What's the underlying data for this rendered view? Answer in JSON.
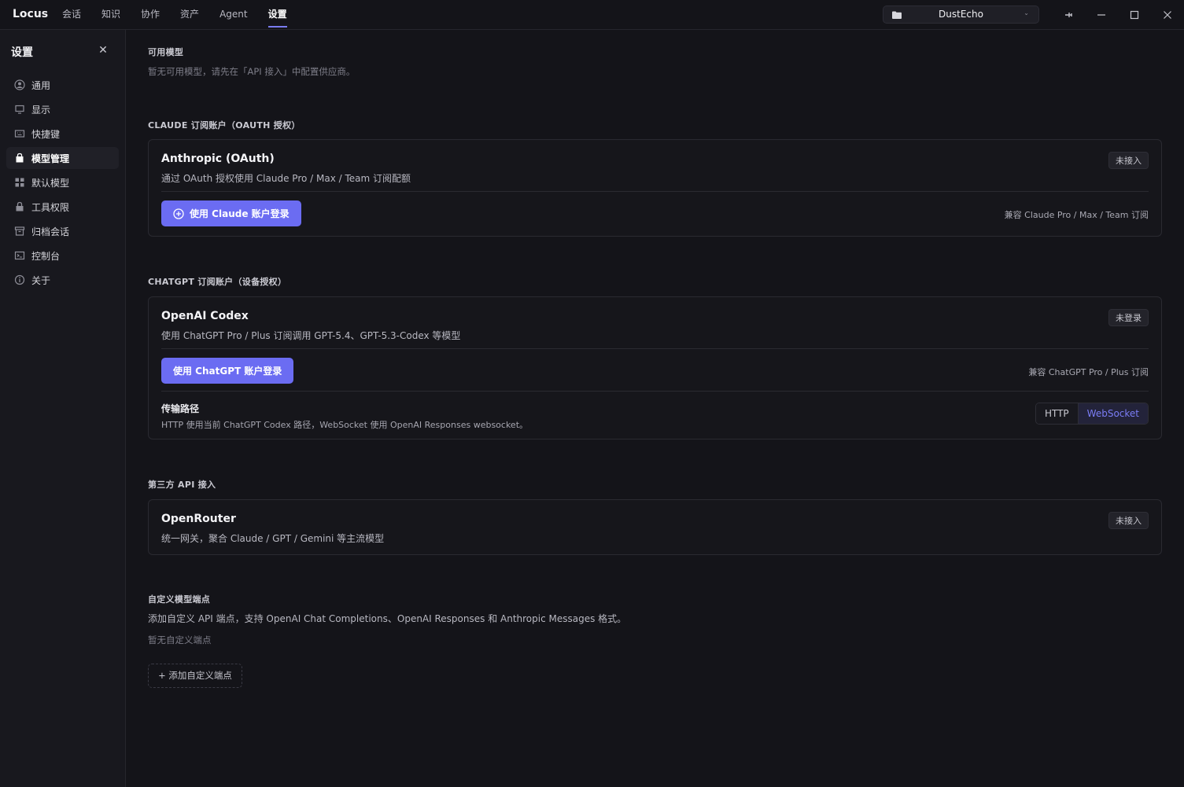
{
  "app": {
    "brand": "Locus",
    "nav": [
      "会话",
      "知识",
      "协作",
      "资产",
      "Agent",
      "设置"
    ],
    "workspace": "DustEcho"
  },
  "sidebar": {
    "title": "设置",
    "items": [
      "通用",
      "显示",
      "快捷键",
      "模型管理",
      "默认模型",
      "工具权限",
      "归档会话",
      "控制台",
      "关于"
    ]
  },
  "available": {
    "label": "可用模型",
    "empty": "暂无可用模型，请先在「API 接入」中配置供应商。"
  },
  "claude": {
    "section": "CLAUDE 订阅账户（OAUTH 授权）",
    "title": "Anthropic (OAuth)",
    "desc": "通过 OAuth 授权使用 Claude Pro / Max / Team 订阅配额",
    "badge": "未接入",
    "button": "使用 Claude 账户登录",
    "compat": "兼容 Claude Pro / Max / Team 订阅"
  },
  "chatgpt": {
    "section": "CHATGPT 订阅账户（设备授权）",
    "title": "OpenAI Codex",
    "desc": "使用 ChatGPT Pro / Plus 订阅调用 GPT-5.4、GPT-5.3-Codex 等模型",
    "badge": "未登录",
    "button": "使用 ChatGPT 账户登录",
    "compat": "兼容 ChatGPT Pro / Plus 订阅",
    "transport_title": "传输路径",
    "transport_desc": "HTTP 使用当前 ChatGPT Codex 路径，WebSocket 使用 OpenAI Responses websocket。",
    "transport_options": [
      "HTTP",
      "WebSocket"
    ],
    "transport_selected": "WebSocket"
  },
  "thirdparty": {
    "section": "第三方 API 接入",
    "title": "OpenRouter",
    "desc": "统一网关，聚合 Claude / GPT / Gemini 等主流模型",
    "badge": "未接入"
  },
  "custom": {
    "label": "自定义模型端点",
    "desc": "添加自定义 API 端点，支持 OpenAI Chat Completions、OpenAI Responses 和 Anthropic Messages 格式。",
    "empty": "暂无自定义端点",
    "add_button": "+ 添加自定义端点"
  },
  "colors": {
    "accent": "#6b6cf2",
    "background": "#141419",
    "sidebar": "#18181e"
  }
}
